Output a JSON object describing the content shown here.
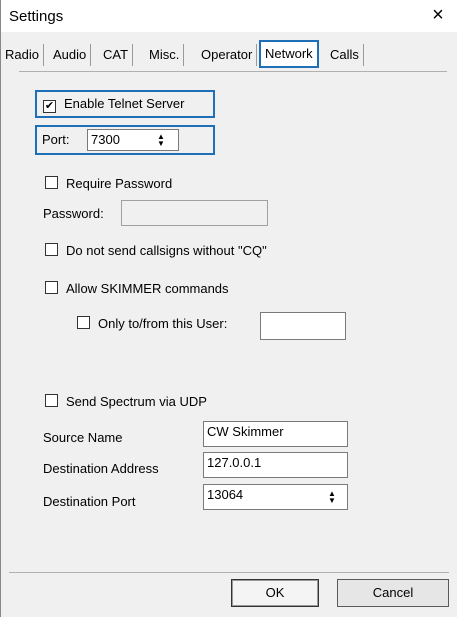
{
  "window": {
    "title": "Settings",
    "close_glyph": "×"
  },
  "tabs": [
    {
      "label": "Radio"
    },
    {
      "label": "Audio"
    },
    {
      "label": "CAT"
    },
    {
      "label": "Misc."
    },
    {
      "label": "Operator"
    },
    {
      "label": "Network"
    },
    {
      "label": "Calls"
    }
  ],
  "active_tab": "Network",
  "network": {
    "enable_telnet": {
      "label": "Enable Telnet Server",
      "checked": true,
      "check_glyph": "✔"
    },
    "port": {
      "label": "Port:",
      "value": "7300"
    },
    "require_password": {
      "label": "Require Password",
      "checked": false
    },
    "password": {
      "label": "Password:",
      "value": ""
    },
    "no_callsigns_without_cq": {
      "label": "Do not send callsigns without \"CQ\"",
      "checked": false
    },
    "allow_skimmer": {
      "label": "Allow SKIMMER commands",
      "checked": false
    },
    "only_this_user": {
      "label": "Only to/from this User:",
      "checked": false,
      "value": ""
    },
    "send_spectrum_udp": {
      "label": "Send Spectrum via UDP",
      "checked": false
    },
    "source_name": {
      "label": "Source Name",
      "value": "CW Skimmer"
    },
    "destination_address": {
      "label": "Destination Address",
      "value": "127.0.0.1"
    },
    "destination_port": {
      "label": "Destination Port",
      "value": "13064"
    }
  },
  "buttons": {
    "ok": "OK",
    "cancel": "Cancel"
  },
  "icons": {
    "spinner_up": "▲",
    "spinner_down": "▼"
  },
  "colors": {
    "highlight": "#1f6fb7",
    "dialog_bg": "#f0f0f0"
  }
}
